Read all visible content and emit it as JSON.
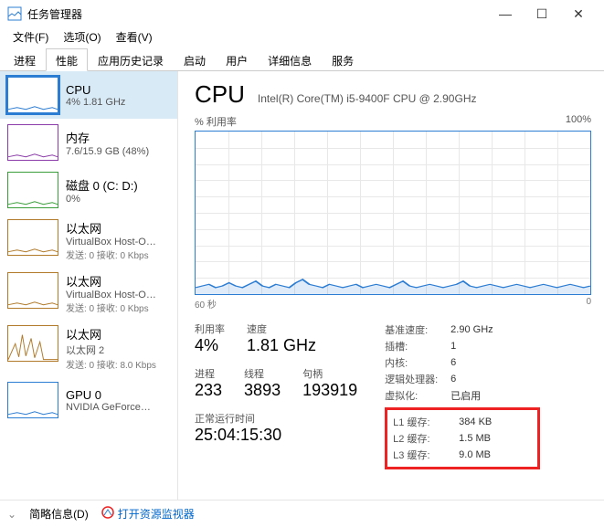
{
  "window": {
    "title": "任务管理器"
  },
  "menus": [
    "文件(F)",
    "选项(O)",
    "查看(V)"
  ],
  "tabs": [
    "进程",
    "性能",
    "应用历史记录",
    "启动",
    "用户",
    "详细信息",
    "服务"
  ],
  "active_tab": 1,
  "sidebar": {
    "items": [
      {
        "name": "CPU",
        "val": "4% 1.81 GHz",
        "color": "#2b7cd3"
      },
      {
        "name": "内存",
        "val": "7.6/15.9 GB (48%)",
        "color": "#8b3ca8"
      },
      {
        "name": "磁盘 0 (C: D:)",
        "val": "0%",
        "color": "#3a9e3a"
      },
      {
        "name": "以太网",
        "val": "VirtualBox Host-O…",
        "sub": "发送: 0 接收: 0 Kbps",
        "color": "#b07a2a"
      },
      {
        "name": "以太网",
        "val": "VirtualBox Host-O…",
        "sub": "发送: 0 接收: 0 Kbps",
        "color": "#b07a2a"
      },
      {
        "name": "以太网",
        "val": "以太网 2",
        "sub": "发送: 0 接收: 8.0 Kbps",
        "color": "#b07a2a"
      },
      {
        "name": "GPU 0",
        "val": "NVIDIA GeForce…",
        "color": "#2b7cd3"
      }
    ]
  },
  "cpu": {
    "title": "CPU",
    "model": "Intel(R) Core(TM) i5-9400F CPU @ 2.90GHz",
    "util_label": "% 利用率",
    "util_max": "100%",
    "axis_left": "60 秒",
    "axis_right": "0",
    "stats": {
      "util_lbl": "利用率",
      "util": "4%",
      "speed_lbl": "速度",
      "speed": "1.81 GHz",
      "proc_lbl": "进程",
      "proc": "233",
      "thread_lbl": "线程",
      "thread": "3893",
      "handle_lbl": "句柄",
      "handle": "193919",
      "uptime_lbl": "正常运行时间",
      "uptime": "25:04:15:30"
    },
    "info": {
      "base_lbl": "基准速度:",
      "base": "2.90 GHz",
      "sockets_lbl": "插槽:",
      "sockets": "1",
      "cores_lbl": "内核:",
      "cores": "6",
      "lp_lbl": "逻辑处理器:",
      "lp": "6",
      "virt_lbl": "虚拟化:",
      "virt": "已启用",
      "l1_lbl": "L1 缓存:",
      "l1": "384 KB",
      "l2_lbl": "L2 缓存:",
      "l2": "1.5 MB",
      "l3_lbl": "L3 缓存:",
      "l3": "9.0 MB"
    }
  },
  "footer": {
    "brief": "简略信息(D)",
    "monitor": "打开资源监视器"
  },
  "chart_data": {
    "type": "line",
    "title": "% 利用率",
    "ylim": [
      0,
      100
    ],
    "xlabel": "60 秒 → 0",
    "values": [
      4,
      5,
      6,
      4,
      5,
      7,
      5,
      4,
      6,
      8,
      5,
      4,
      6,
      5,
      4,
      7,
      9,
      6,
      5,
      4,
      6,
      5,
      4,
      5,
      6,
      4,
      5,
      6,
      5,
      4,
      6,
      8,
      5,
      4,
      5,
      6,
      5,
      4,
      5,
      6,
      8,
      5,
      4,
      5,
      6,
      5,
      4,
      5,
      6,
      5,
      4,
      5,
      6,
      5,
      4,
      5,
      6,
      5,
      4,
      5
    ]
  }
}
